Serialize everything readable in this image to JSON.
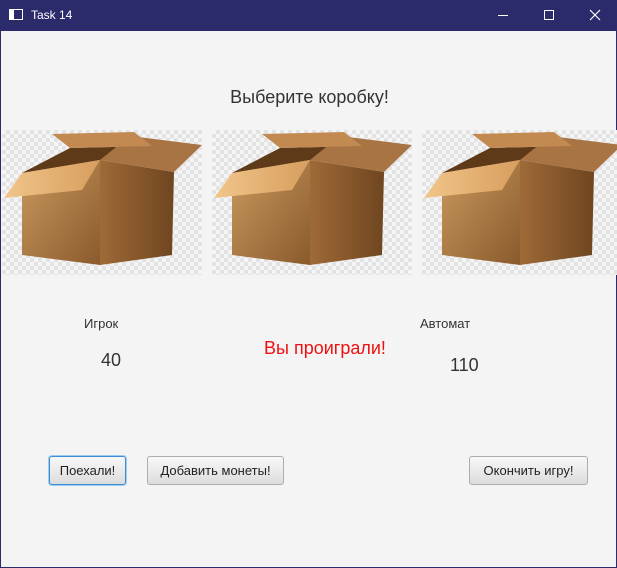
{
  "window": {
    "title": "Task 14",
    "controls": [
      "minimize-icon",
      "maximize-icon",
      "close-icon"
    ]
  },
  "heading": "Выберите коробку!",
  "boxes": [
    {
      "image": "open-cardboard-box"
    },
    {
      "image": "open-cardboard-box"
    },
    {
      "image": "open-cardboard-box"
    }
  ],
  "player": {
    "label": "Игрок",
    "value": "40"
  },
  "machine": {
    "label": "Автомат",
    "value": "110"
  },
  "result_text": "Вы проиграли!",
  "buttons": {
    "go": "Поехали!",
    "add_coins": "Добавить монеты!",
    "end_game": "Окончить игру!"
  },
  "colors": {
    "titlebar": "#2b2a6b",
    "result": "#e11111",
    "focus": "#3b8fd8"
  }
}
